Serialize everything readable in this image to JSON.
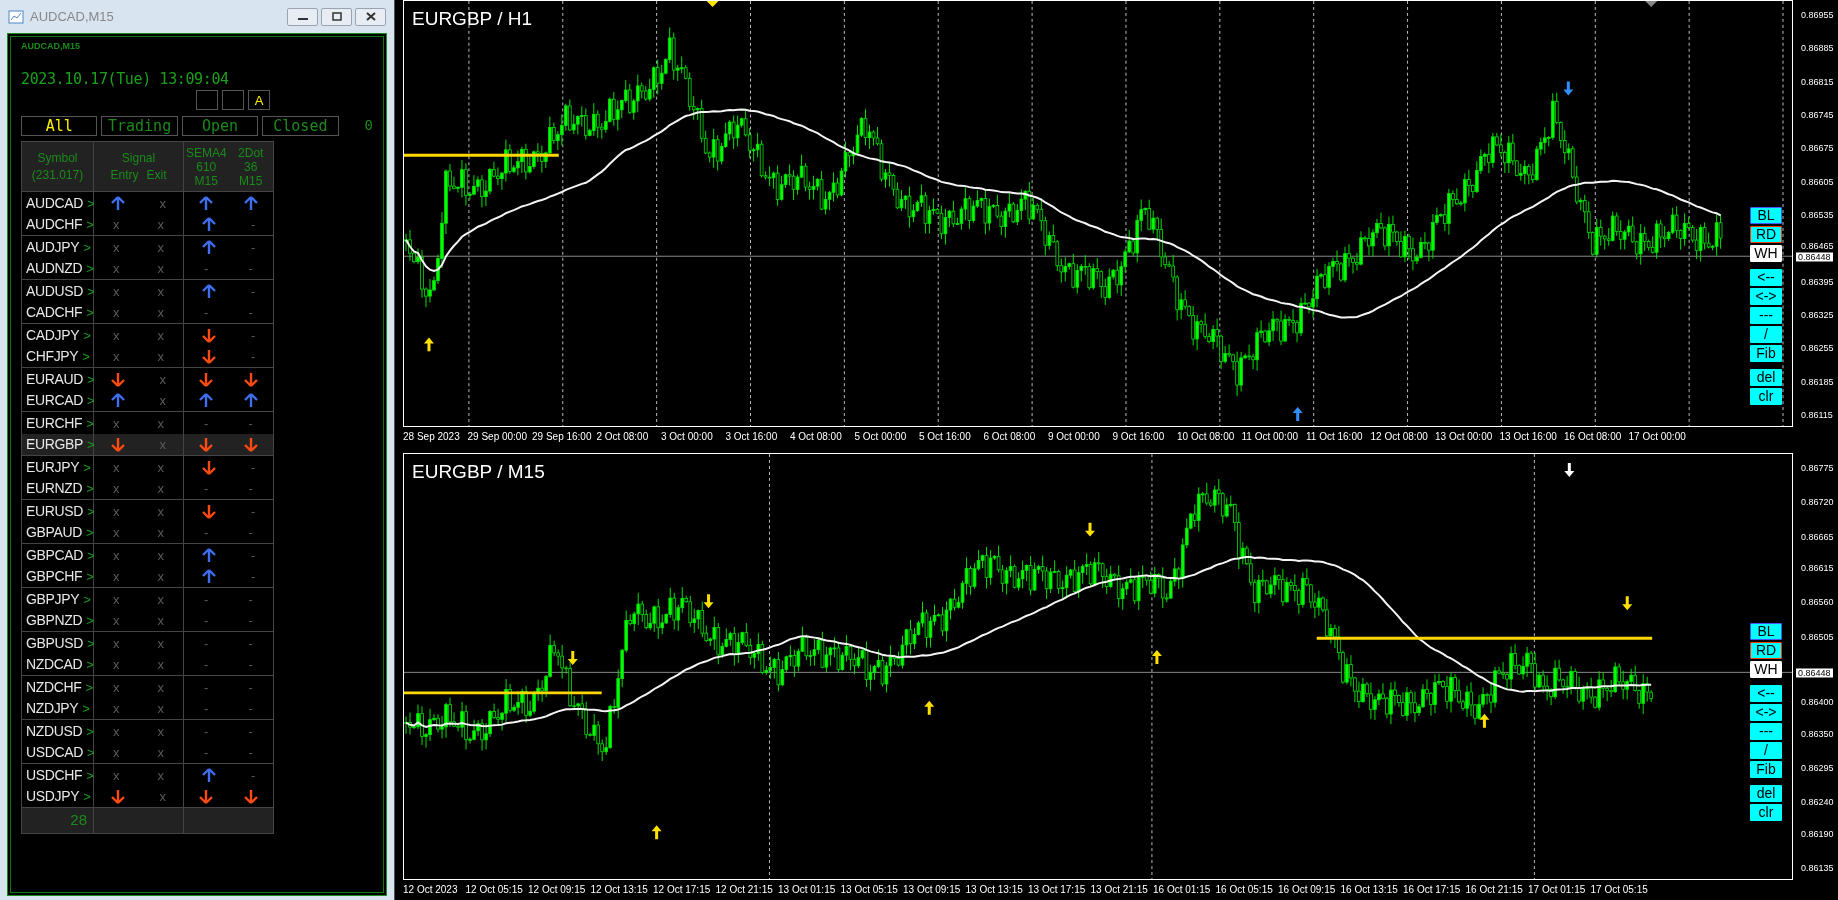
{
  "window": {
    "title": "AUDCAD,M15"
  },
  "panel": {
    "caption": "AUDCAD,M15",
    "datetime": "2023.10.17(Tue) 13:09:04",
    "mode_buttons": [
      {
        "kind": "blank"
      },
      {
        "kind": "blank"
      },
      {
        "kind": "label",
        "text": "A"
      }
    ],
    "filters": [
      {
        "label": "All",
        "selected": true
      },
      {
        "label": "Trading",
        "selected": false
      },
      {
        "label": "Open",
        "selected": false
      },
      {
        "label": "Closed",
        "selected": false
      }
    ],
    "filter_count": "0",
    "header": {
      "symbol": "Symbol",
      "count": "(231.017)",
      "signal": "Signal",
      "entry": "Entry",
      "exit": "Exit",
      "indicators": [
        [
          "SEMA4",
          "610",
          "M15"
        ],
        [
          "2Dot",
          "36",
          "M15"
        ]
      ]
    },
    "rows": [
      {
        "symbol": "AUDCAD",
        "open": ">",
        "selected": false,
        "cells": [
          {
            "kind": "up"
          },
          {
            "kind": "mark",
            "text": "x"
          },
          {
            "kind": "up"
          },
          {
            "kind": "up"
          }
        ]
      },
      {
        "symbol": "AUDCHF",
        "open": ">",
        "selected": false,
        "cells": [
          {
            "kind": "mark",
            "text": "x"
          },
          {
            "kind": "mark",
            "text": "x"
          },
          {
            "kind": "up"
          },
          {
            "kind": "mark",
            "text": "-"
          }
        ]
      },
      {
        "symbol": "AUDJPY",
        "open": ">",
        "selected": false,
        "cells": [
          {
            "kind": "mark",
            "text": "x"
          },
          {
            "kind": "mark",
            "text": "x"
          },
          {
            "kind": "up"
          },
          {
            "kind": "mark",
            "text": "-"
          }
        ]
      },
      {
        "symbol": "AUDNZD",
        "open": ">",
        "selected": false,
        "cells": [
          {
            "kind": "mark",
            "text": "x"
          },
          {
            "kind": "mark",
            "text": "x"
          },
          {
            "kind": "mark",
            "text": "-"
          },
          {
            "kind": "mark",
            "text": "-"
          }
        ]
      },
      {
        "symbol": "AUDUSD",
        "open": ">",
        "selected": false,
        "cells": [
          {
            "kind": "mark",
            "text": "x"
          },
          {
            "kind": "mark",
            "text": "x"
          },
          {
            "kind": "up"
          },
          {
            "kind": "mark",
            "text": "-"
          }
        ]
      },
      {
        "symbol": "CADCHF",
        "open": ">",
        "selected": false,
        "cells": [
          {
            "kind": "mark",
            "text": "x"
          },
          {
            "kind": "mark",
            "text": "x"
          },
          {
            "kind": "mark",
            "text": "-"
          },
          {
            "kind": "mark",
            "text": "-"
          }
        ]
      },
      {
        "symbol": "CADJPY",
        "open": ">",
        "selected": false,
        "cells": [
          {
            "kind": "mark",
            "text": "x"
          },
          {
            "kind": "mark",
            "text": "x"
          },
          {
            "kind": "down"
          },
          {
            "kind": "mark",
            "text": "-"
          }
        ]
      },
      {
        "symbol": "CHFJPY",
        "open": ">",
        "selected": false,
        "cells": [
          {
            "kind": "mark",
            "text": "x"
          },
          {
            "kind": "mark",
            "text": "x"
          },
          {
            "kind": "down"
          },
          {
            "kind": "mark",
            "text": "-"
          }
        ]
      },
      {
        "symbol": "EURAUD",
        "open": ">",
        "selected": false,
        "cells": [
          {
            "kind": "down"
          },
          {
            "kind": "mark",
            "text": "x"
          },
          {
            "kind": "down"
          },
          {
            "kind": "down"
          }
        ]
      },
      {
        "symbol": "EURCAD",
        "open": ">",
        "selected": false,
        "cells": [
          {
            "kind": "up"
          },
          {
            "kind": "mark",
            "text": "x"
          },
          {
            "kind": "up"
          },
          {
            "kind": "up"
          }
        ]
      },
      {
        "symbol": "EURCHF",
        "open": ">",
        "selected": false,
        "cells": [
          {
            "kind": "mark",
            "text": "x"
          },
          {
            "kind": "mark",
            "text": "x"
          },
          {
            "kind": "mark",
            "text": "-"
          },
          {
            "kind": "mark",
            "text": "-"
          }
        ]
      },
      {
        "symbol": "EURGBP",
        "open": ">",
        "selected": true,
        "cells": [
          {
            "kind": "down"
          },
          {
            "kind": "mark",
            "text": "x"
          },
          {
            "kind": "down"
          },
          {
            "kind": "down"
          }
        ]
      },
      {
        "symbol": "EURJPY",
        "open": ">",
        "selected": false,
        "cells": [
          {
            "kind": "mark",
            "text": "x"
          },
          {
            "kind": "mark",
            "text": "x"
          },
          {
            "kind": "down"
          },
          {
            "kind": "mark",
            "text": "-"
          }
        ]
      },
      {
        "symbol": "EURNZD",
        "open": ">",
        "selected": false,
        "cells": [
          {
            "kind": "mark",
            "text": "x"
          },
          {
            "kind": "mark",
            "text": "x"
          },
          {
            "kind": "mark",
            "text": "-"
          },
          {
            "kind": "mark",
            "text": "-"
          }
        ]
      },
      {
        "symbol": "EURUSD",
        "open": ">",
        "selected": false,
        "cells": [
          {
            "kind": "mark",
            "text": "x"
          },
          {
            "kind": "mark",
            "text": "x"
          },
          {
            "kind": "down"
          },
          {
            "kind": "mark",
            "text": "-"
          }
        ]
      },
      {
        "symbol": "GBPAUD",
        "open": ">",
        "selected": false,
        "cells": [
          {
            "kind": "mark",
            "text": "x"
          },
          {
            "kind": "mark",
            "text": "x"
          },
          {
            "kind": "mark",
            "text": "-"
          },
          {
            "kind": "mark",
            "text": "-"
          }
        ]
      },
      {
        "symbol": "GBPCAD",
        "open": ">",
        "selected": false,
        "cells": [
          {
            "kind": "mark",
            "text": "x"
          },
          {
            "kind": "mark",
            "text": "x"
          },
          {
            "kind": "up"
          },
          {
            "kind": "mark",
            "text": "-"
          }
        ]
      },
      {
        "symbol": "GBPCHF",
        "open": ">",
        "selected": false,
        "cells": [
          {
            "kind": "mark",
            "text": "x"
          },
          {
            "kind": "mark",
            "text": "x"
          },
          {
            "kind": "up"
          },
          {
            "kind": "mark",
            "text": "-"
          }
        ]
      },
      {
        "symbol": "GBPJPY",
        "open": ">",
        "selected": false,
        "cells": [
          {
            "kind": "mark",
            "text": "x"
          },
          {
            "kind": "mark",
            "text": "x"
          },
          {
            "kind": "mark",
            "text": "-"
          },
          {
            "kind": "mark",
            "text": "-"
          }
        ]
      },
      {
        "symbol": "GBPNZD",
        "open": ">",
        "selected": false,
        "cells": [
          {
            "kind": "mark",
            "text": "x"
          },
          {
            "kind": "mark",
            "text": "x"
          },
          {
            "kind": "mark",
            "text": "-"
          },
          {
            "kind": "mark",
            "text": "-"
          }
        ]
      },
      {
        "symbol": "GBPUSD",
        "open": ">",
        "selected": false,
        "cells": [
          {
            "kind": "mark",
            "text": "x"
          },
          {
            "kind": "mark",
            "text": "x"
          },
          {
            "kind": "mark",
            "text": "-"
          },
          {
            "kind": "mark",
            "text": "-"
          }
        ]
      },
      {
        "symbol": "NZDCAD",
        "open": ">",
        "selected": false,
        "cells": [
          {
            "kind": "mark",
            "text": "x"
          },
          {
            "kind": "mark",
            "text": "x"
          },
          {
            "kind": "mark",
            "text": "-"
          },
          {
            "kind": "mark",
            "text": "-"
          }
        ]
      },
      {
        "symbol": "NZDCHF",
        "open": ">",
        "selected": false,
        "cells": [
          {
            "kind": "mark",
            "text": "x"
          },
          {
            "kind": "mark",
            "text": "x"
          },
          {
            "kind": "mark",
            "text": "-"
          },
          {
            "kind": "mark",
            "text": "-"
          }
        ]
      },
      {
        "symbol": "NZDJPY",
        "open": ">",
        "selected": false,
        "cells": [
          {
            "kind": "mark",
            "text": "x"
          },
          {
            "kind": "mark",
            "text": "x"
          },
          {
            "kind": "mark",
            "text": "-"
          },
          {
            "kind": "mark",
            "text": "-"
          }
        ]
      },
      {
        "symbol": "NZDUSD",
        "open": ">",
        "selected": false,
        "cells": [
          {
            "kind": "mark",
            "text": "x"
          },
          {
            "kind": "mark",
            "text": "x"
          },
          {
            "kind": "mark",
            "text": "-"
          },
          {
            "kind": "mark",
            "text": "-"
          }
        ]
      },
      {
        "symbol": "USDCAD",
        "open": ">",
        "selected": false,
        "cells": [
          {
            "kind": "mark",
            "text": "x"
          },
          {
            "kind": "mark",
            "text": "x"
          },
          {
            "kind": "mark",
            "text": "-"
          },
          {
            "kind": "mark",
            "text": "-"
          }
        ]
      },
      {
        "symbol": "USDCHF",
        "open": ">",
        "selected": false,
        "cells": [
          {
            "kind": "mark",
            "text": "x"
          },
          {
            "kind": "mark",
            "text": "x"
          },
          {
            "kind": "up"
          },
          {
            "kind": "mark",
            "text": "-"
          }
        ]
      },
      {
        "symbol": "USDJPY",
        "open": ">",
        "selected": false,
        "cells": [
          {
            "kind": "down"
          },
          {
            "kind": "mark",
            "text": "x"
          },
          {
            "kind": "down"
          },
          {
            "kind": "down"
          }
        ]
      }
    ],
    "footer_count": "28"
  },
  "charts": [
    {
      "title": "EURGBP / H1",
      "price_tag": "0.86448",
      "price_labels": [
        "0.86955",
        "0.86885",
        "0.86815",
        "0.86745",
        "0.86675",
        "0.86605",
        "0.86535",
        "0.86465",
        "0.86395",
        "0.86325",
        "0.86255",
        "0.86185",
        "0.86115"
      ],
      "time_labels": [
        "28 Sep 2023",
        "29 Sep 00:00",
        "29 Sep 16:00",
        "2 Oct 08:00",
        "3 Oct 00:00",
        "3 Oct 16:00",
        "4 Oct 08:00",
        "5 Oct 00:00",
        "5 Oct 16:00",
        "6 Oct 08:00",
        "9 Oct 00:00",
        "9 Oct 16:00",
        "10 Oct 08:00",
        "11 Oct 00:00",
        "11 Oct 16:00",
        "12 Oct 08:00",
        "13 Oct 00:00",
        "13 Oct 16:00",
        "16 Oct 08:00",
        "17 Oct 00:00"
      ],
      "tools": [
        {
          "kind": "color",
          "label": "BL",
          "color": "#3f5bff",
          "selected": false
        },
        {
          "kind": "color",
          "label": "RD",
          "color": "#ff3c00",
          "selected": false
        },
        {
          "kind": "color",
          "label": "WH",
          "color": "#ffffff",
          "selected": true
        },
        {
          "kind": "tool",
          "label": "<--"
        },
        {
          "kind": "tool",
          "label": "<->"
        },
        {
          "kind": "tool",
          "label": "---"
        },
        {
          "kind": "tool",
          "label": "/"
        },
        {
          "kind": "tool",
          "label": "Fib"
        },
        {
          "kind": "tool",
          "label": "del"
        },
        {
          "kind": "tool",
          "label": "clr"
        }
      ]
    },
    {
      "title": "EURGBP / M15",
      "price_tag": "0.86448",
      "price_labels": [
        "0.86775",
        "0.86720",
        "0.86665",
        "0.86615",
        "0.86560",
        "0.86505",
        "0.86400",
        "0.86350",
        "0.86295",
        "0.86240",
        "0.86190",
        "0.86135"
      ],
      "time_labels": [
        "12 Oct 2023",
        "12 Oct 05:15",
        "12 Oct 09:15",
        "12 Oct 13:15",
        "12 Oct 17:15",
        "12 Oct 21:15",
        "13 Oct 01:15",
        "13 Oct 05:15",
        "13 Oct 09:15",
        "13 Oct 13:15",
        "13 Oct 17:15",
        "13 Oct 21:15",
        "16 Oct 01:15",
        "16 Oct 05:15",
        "16 Oct 09:15",
        "16 Oct 13:15",
        "16 Oct 17:15",
        "16 Oct 21:15",
        "17 Oct 01:15",
        "17 Oct 05:15"
      ],
      "tools": [
        {
          "kind": "color",
          "label": "BL",
          "color": "#3f5bff",
          "selected": false
        },
        {
          "kind": "color",
          "label": "RD",
          "color": "#ff3c00",
          "selected": false
        },
        {
          "kind": "color",
          "label": "WH",
          "color": "#ffffff",
          "selected": true
        },
        {
          "kind": "tool",
          "label": "<--"
        },
        {
          "kind": "tool",
          "label": "<->"
        },
        {
          "kind": "tool",
          "label": "---"
        },
        {
          "kind": "tool",
          "label": "/"
        },
        {
          "kind": "tool",
          "label": "Fib"
        },
        {
          "kind": "tool",
          "label": "del"
        },
        {
          "kind": "tool",
          "label": "clr"
        }
      ]
    }
  ]
}
